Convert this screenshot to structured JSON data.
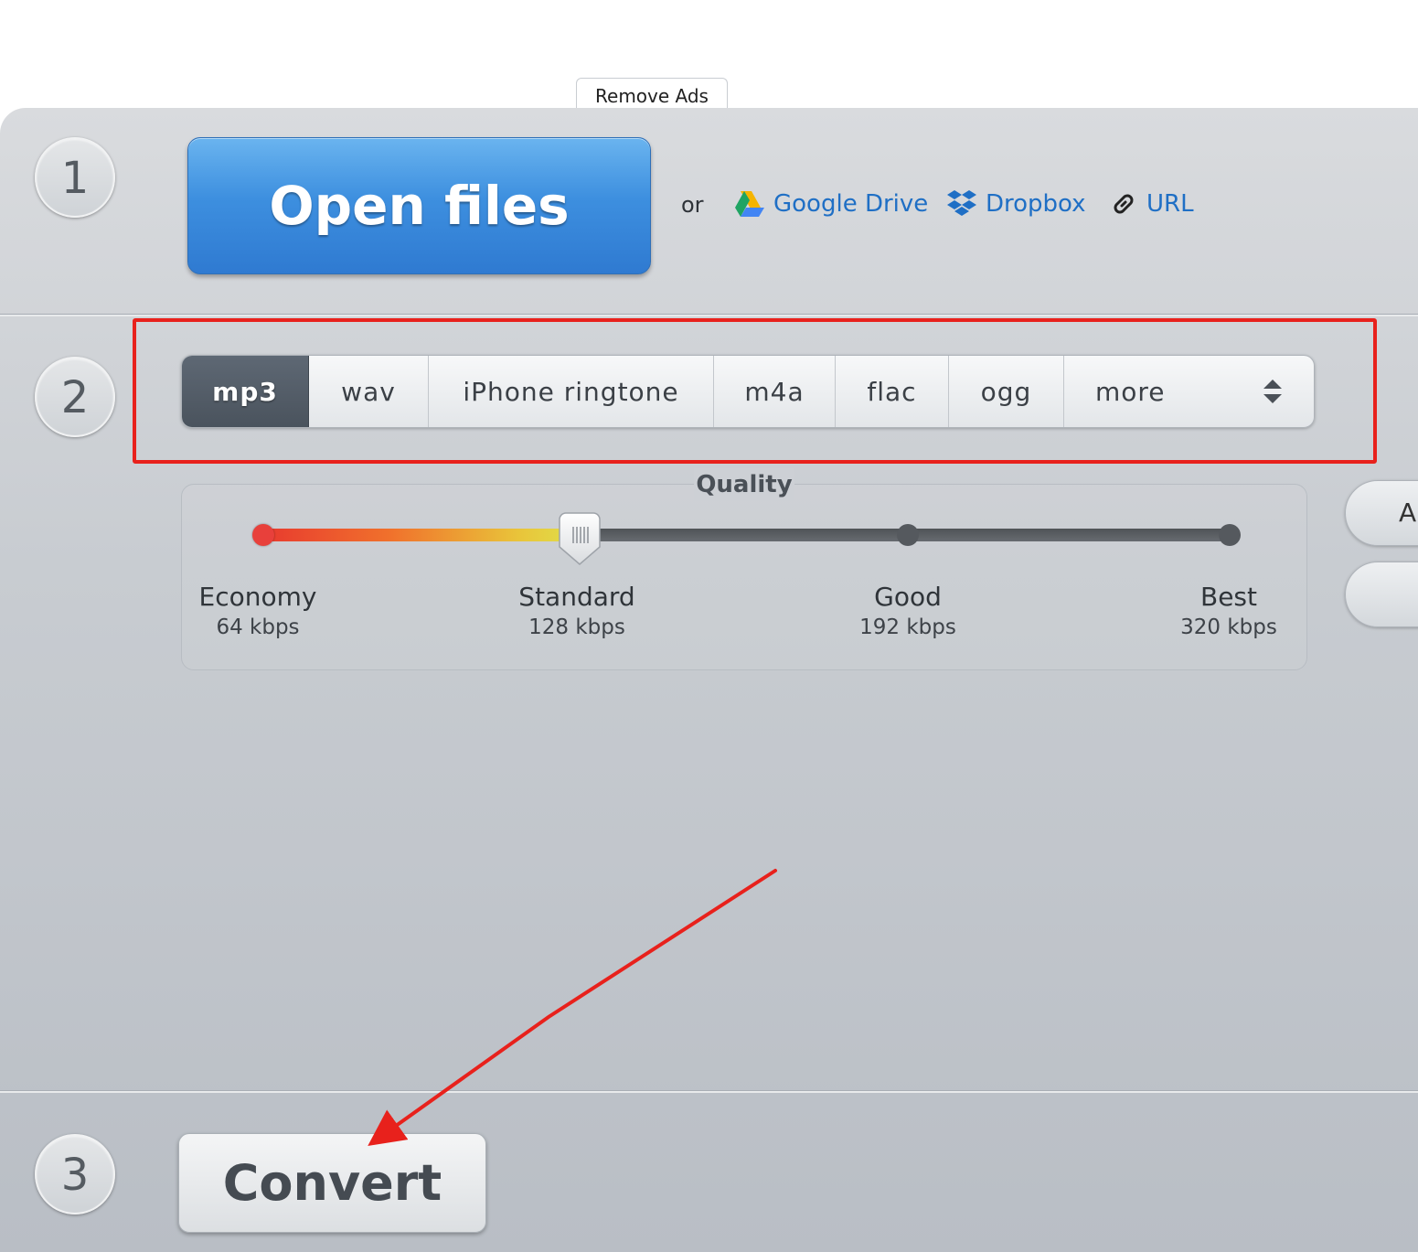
{
  "remove_ads_label": "Remove Ads",
  "steps": {
    "one": "1",
    "two": "2",
    "three": "3"
  },
  "open_files": {
    "label": "Open files",
    "or_text": "or",
    "sources": {
      "google_drive": "Google Drive",
      "dropbox": "Dropbox",
      "url": "URL"
    }
  },
  "formats": {
    "items": [
      "mp3",
      "wav",
      "iPhone ringtone",
      "m4a",
      "flac",
      "ogg",
      "more"
    ],
    "selected": "mp3"
  },
  "quality": {
    "title": "Quality",
    "levels": [
      {
        "name": "Economy",
        "rate": "64 kbps"
      },
      {
        "name": "Standard",
        "rate": "128 kbps"
      },
      {
        "name": "Good",
        "rate": "192 kbps"
      },
      {
        "name": "Best",
        "rate": "320 kbps"
      }
    ],
    "selected_level": "Standard"
  },
  "side_button_label": "A",
  "convert_label": "Convert",
  "colors": {
    "primary_blue": "#3d8fdf",
    "link_blue": "#1f6fc5",
    "highlight_red": "#e8211c",
    "active_tab": "#4a535d"
  }
}
